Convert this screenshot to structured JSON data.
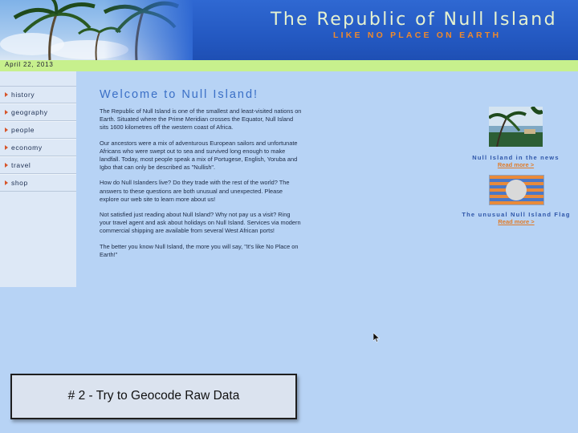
{
  "header": {
    "title": "The Republic of Null Island",
    "tagline": "LIKE NO PLACE ON EARTH",
    "photo_icon": "palm-tree-photo"
  },
  "date": "April 22, 2013",
  "nav": {
    "items": [
      {
        "label": "history"
      },
      {
        "label": "geography"
      },
      {
        "label": "people"
      },
      {
        "label": "economy"
      },
      {
        "label": "travel"
      },
      {
        "label": "shop"
      }
    ],
    "bullet_color": "#d6552b"
  },
  "main": {
    "heading": "Welcome to Null Island!",
    "paragraphs": [
      "The Republic of Null Island is one of the smallest and least-visited nations on Earth. Situated where the Prime Meridian crosses the Equator, Null Island sits 1600 kilometres off the western coast of Africa.",
      "Our ancestors were a mix of adventurous European sailors and unfortunate Africans who were swept out to sea and survived long enough to make landfall. Today, most people speak a mix of Portugese, English, Yoruba and Igbo that can only be described as \"Nullish\".",
      "How do Null Islanders live? Do they trade with the rest of the world? The answers to these questions are both unusual and unexpected. Please explore our web site to learn more about us!",
      "Not satisfied just reading about Null Island? Why not pay us a visit? Ring your travel agent and ask about holidays on Null Island. Services via modern commercial shipping are available from several West African ports!",
      "The better you know Null Island, the more you will say, \"It's like No Place on Earth!\""
    ]
  },
  "sidebar_right": {
    "news": {
      "caption": "Null Island in the news",
      "link": "Read more >"
    },
    "flag": {
      "caption": "The unusual Null Island Flag",
      "link": "Read more >"
    }
  },
  "slide_caption": "# 2 - Try to Geocode Raw Data",
  "colors": {
    "header_blue": "#2f68d2",
    "title": "#e6f2d0",
    "tagline": "#f08a2c",
    "datebar": "#c7f08d",
    "background": "#b7d3f5",
    "link": "#e07b28"
  }
}
